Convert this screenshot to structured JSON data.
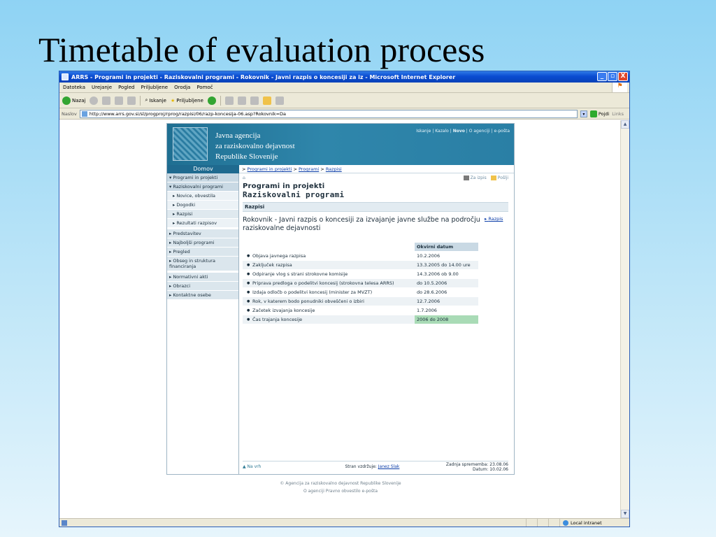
{
  "slide": {
    "title": "Timetable of evaluation process"
  },
  "window": {
    "title": "ARRS - Programi in projekti - Raziskovalni programi - Rokovnik - Javni razpis o koncesiji za iz - Microsoft Internet Explorer",
    "buttons": [
      "_",
      "▫",
      "X"
    ]
  },
  "menu": [
    "Datoteka",
    "Urejanje",
    "Pogled",
    "Priljubljene",
    "Orodja",
    "Pomoč"
  ],
  "toolbar": {
    "back": "Nazaj",
    "search": "Iskanje",
    "favorites": "Priljubljene"
  },
  "address": {
    "label": "Naslov",
    "url": "http://www.arrs.gov.si/sl/progproj/rprog/razpisi/06/razp-koncesija-06.asp?Rokovnik=Da",
    "go": "Pojdi",
    "links": "Links"
  },
  "site": {
    "name_lines": [
      "Javna agencija",
      "za raziskovalno dejavnost",
      "Republike Slovenije"
    ],
    "top_links": {
      "a": "Iskanje",
      "b": "Kazalo",
      "c": "Novo",
      "d": "O agenciji",
      "e": "e-pošta"
    },
    "home": "Domov",
    "breadcrumb": {
      "prefix": ">",
      "a": "Programi in projekti",
      "b": "Programi",
      "c": "Razpisi"
    },
    "nav": [
      "▾ Programi in projekti",
      "▾ Raziskovalni programi",
      "▸ Novice, obvestila",
      "▸ Dogodki",
      "▸ Razpisi",
      "▸ Rezultati razpisov",
      "▸ Predstavitev",
      "▸ Najboljši programi",
      "▸ Pregled",
      "▸ Obseg in struktura financiranja",
      "▸ Normativni akti",
      "▸ Obrazci",
      "▸ Kontaktne osebe"
    ],
    "print_label": "Za izpis",
    "send_label": "Pošlji",
    "section": "Programi in projekti",
    "subsection": "Raziskovalni programi",
    "bar": "Razpisi",
    "notice_title": "Rokovnik - Javni razpis o koncesiji za izvajanje javne službe na področju raziskovalne dejavnosti",
    "notice_link": "Razpis",
    "table_header": "Okvirni datum",
    "rows": [
      {
        "task": "Objava javnega razpisa",
        "date": "10.2.2006"
      },
      {
        "task": "Zaključek razpisa",
        "date": "13.3.2005 do 14.00 ure"
      },
      {
        "task": "Odpiranje vlog s strani strokovne komisije",
        "date": "14.3.2006 ob 9.00"
      },
      {
        "task": "Priprava predloga o podelitvi koncesij (strokovna telesa ARRS)",
        "date": "do 10.5.2006"
      },
      {
        "task": "Izdaja odločb o podelitvi koncesij (minister za MVZT)",
        "date": "do 28.6.2006"
      },
      {
        "task": "Rok, v katerem bodo ponudniki obveščeni o izbiri",
        "date": "12.7.2006"
      },
      {
        "task": "Začetek izvajanja koncesije",
        "date": "1.7.2006"
      },
      {
        "task": "Čas trajanja koncesije",
        "date": "2006 do 2008"
      }
    ],
    "footer": {
      "back_top": "▲ Na vrh",
      "maintainer_label": "Stran vzdržuje:",
      "maintainer": "Janez Slak",
      "last_change": "Zadnja sprememba: 23.08.06",
      "date": "Datum: 10.02.06"
    },
    "copyright": "© Agencija za raziskovalno dejavnost Republike Slovenije",
    "bottom_links": "O agenciji  Pravno obvestilo  e-pošta"
  },
  "status": {
    "zone": "Local intranet"
  }
}
